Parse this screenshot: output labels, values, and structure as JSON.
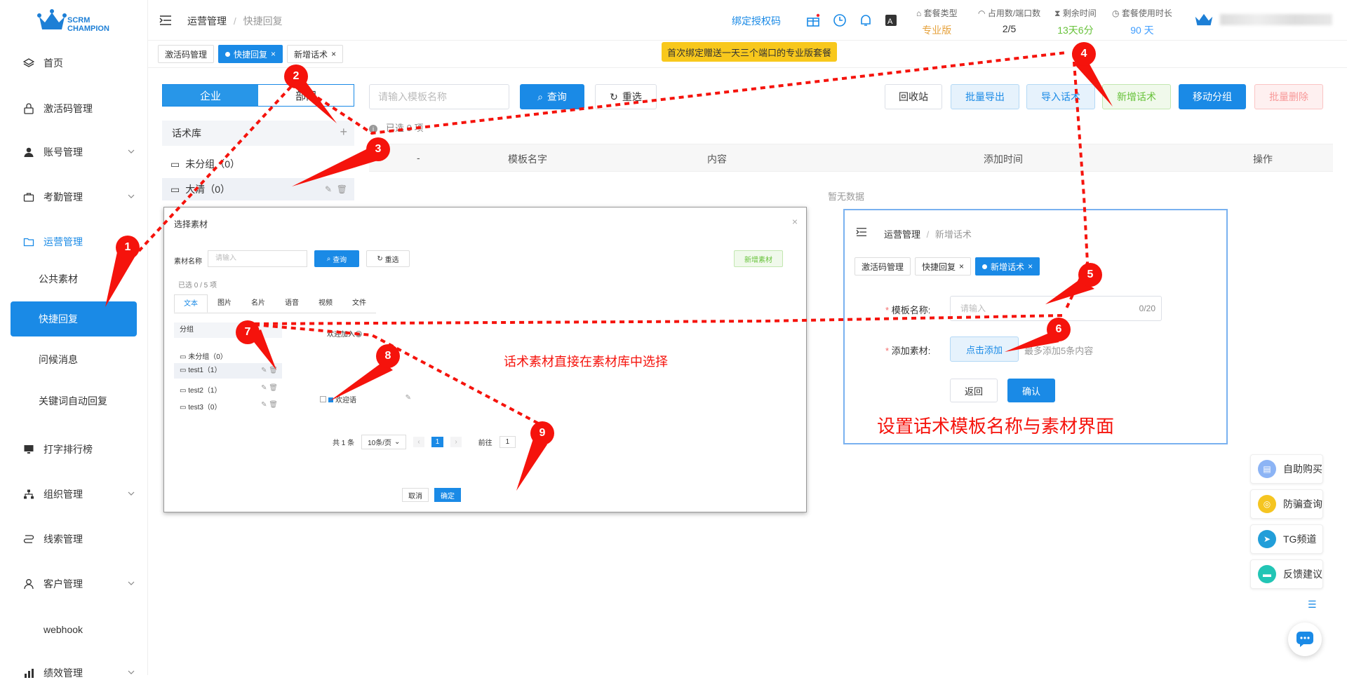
{
  "brand": {
    "line1": "SCRM",
    "line2": "CHAMPION"
  },
  "sidebar": {
    "items": [
      {
        "label": "首页"
      },
      {
        "label": "激活码管理"
      },
      {
        "label": "账号管理"
      },
      {
        "label": "考勤管理"
      },
      {
        "label": "运营管理"
      },
      {
        "label": "打字排行榜"
      },
      {
        "label": "组织管理"
      },
      {
        "label": "线索管理"
      },
      {
        "label": "客户管理"
      },
      {
        "label": "webhook"
      },
      {
        "label": "绩效管理"
      }
    ],
    "sub_items": [
      {
        "label": "公共素材"
      },
      {
        "label": "快捷回复"
      },
      {
        "label": "问候消息"
      },
      {
        "label": "关键词自动回复"
      }
    ]
  },
  "header": {
    "crumb_parent": "运营管理",
    "crumb_sep": "/",
    "crumb_current": "快捷回复",
    "bind_link": "绑定授权码",
    "promo": "首次绑定赠送一天三个端口的专业版套餐",
    "stats": [
      {
        "label": "套餐类型",
        "value": "专业版",
        "color": "#e6a23c"
      },
      {
        "label": "占用数/端口数",
        "value": "2/5",
        "color": "#333333"
      },
      {
        "label": "剩余时间",
        "value": "13天6分",
        "color": "#67c23a"
      },
      {
        "label": "套餐使用时长",
        "value": "90 天",
        "color": "#409eff"
      }
    ]
  },
  "tabs": [
    {
      "label": "激活码管理"
    },
    {
      "label": "快捷回复"
    },
    {
      "label": "新增话术"
    }
  ],
  "main": {
    "seg_left": "企业",
    "seg_right": "部门",
    "library_title": "话术库",
    "groups": [
      {
        "label": "未分组（0）"
      },
      {
        "label": "大清（0）"
      }
    ],
    "search_placeholder": "请输入模板名称",
    "query_btn": "查询",
    "reset_btn": "重选",
    "selected_text": "已选 0 项",
    "actions": [
      "回收站",
      "批量导出",
      "导入话术",
      "新增话术",
      "移动分组",
      "批量删除"
    ],
    "columns": [
      "-",
      "模板名字",
      "内容",
      "添加时间",
      "操作"
    ],
    "empty": "暂无数据"
  },
  "dialog": {
    "title": "选择素材",
    "name_label": "素材名称",
    "name_placeholder": "请输入",
    "query": "查询",
    "reset": "重选",
    "add": "新增素材",
    "selected": "已选 0 / 5 项",
    "tabs": [
      "文本",
      "图片",
      "名片",
      "语音",
      "视频",
      "文件"
    ],
    "group_header": "分组",
    "groups": [
      "未分组（0）",
      "test1（1）",
      "test2（1）",
      "test3（0）"
    ],
    "item_header": "欢迎加入😀",
    "item": "欢迎语",
    "pager_total": "共 1 条",
    "pager_size": "10条/页",
    "pager_page": "1",
    "pager_goto": "前往",
    "pager_goto_val": "1",
    "cancel": "取消",
    "confirm": "确定",
    "annotation": "话术素材直接在素材库中选择"
  },
  "panel": {
    "crumb_parent": "运营管理",
    "crumb_sep": "/",
    "crumb_current": "新增话术",
    "tabs": [
      "激活码管理",
      "快捷回复",
      "新增话术"
    ],
    "name_label": "模板名称:",
    "name_placeholder": "请输入",
    "name_counter": "0/20",
    "material_label": "添加素材:",
    "material_btn": "点击添加",
    "material_hint": "最多添加5条内容",
    "back": "返回",
    "ok": "确认",
    "annotation": "设置话术模板名称与素材界面"
  },
  "float": [
    {
      "label": "自助购买",
      "color": "#8cb4f5"
    },
    {
      "label": "防骗查询",
      "color": "#f5c521"
    },
    {
      "label": "TG频道",
      "color": "#229ed9"
    },
    {
      "label": "反馈建议",
      "color": "#22c5b5"
    }
  ],
  "pins": [
    "1",
    "2",
    "3",
    "4",
    "5",
    "6",
    "7",
    "8",
    "9"
  ],
  "colors": {
    "primary": "#1a8ae6",
    "annotation": "#f5130c"
  }
}
